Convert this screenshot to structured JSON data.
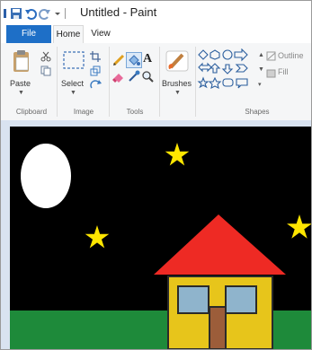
{
  "app": {
    "title": "Untitled - Paint"
  },
  "tabs": {
    "file": "File",
    "home": "Home",
    "view": "View"
  },
  "ribbon": {
    "paste_label": "Paste",
    "select_label": "Select",
    "brushes_label": "Brushes",
    "outline_label": "Outline",
    "fill_label": "Fill",
    "groups": {
      "clipboard": "Clipboard",
      "image": "Image",
      "tools": "Tools",
      "shapes": "Shapes"
    }
  },
  "colors": {
    "accent": "#1e6fc7",
    "sky": "#000000",
    "moon": "#ffffff",
    "star": "#ffe600",
    "ground": "#1e8a3a",
    "roof": "#ee2a24",
    "wall": "#e7c51b",
    "window": "#8fb4cc",
    "door": "#9c5d3a"
  },
  "icons": [
    "save-icon",
    "undo-icon",
    "redo-icon",
    "customize-icon",
    "paste-icon",
    "cut-icon",
    "copy-icon",
    "select-icon",
    "crop-icon",
    "resize-icon",
    "rotate-icon",
    "pencil-icon",
    "fill-icon",
    "text-icon",
    "eraser-icon",
    "color-picker-icon",
    "magnifier-icon",
    "brushes-icon",
    "shapes-gallery"
  ]
}
